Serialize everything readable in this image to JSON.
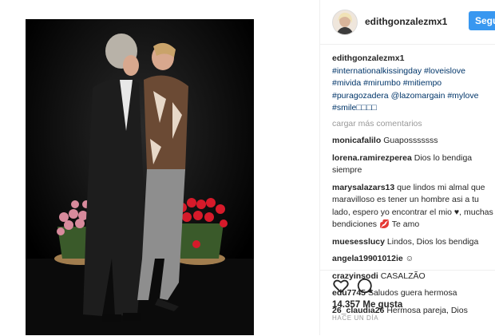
{
  "post": {
    "username": "edithgonzalezmx1",
    "follow_label": "Seguir",
    "caption_user": "edithgonzalezmx1",
    "caption_tags": "#internationalkissingday #loveislove #mivida #mirumbo #mitiempo #puragozadera",
    "caption_mention_line": "@lazomargain #mylove #smile",
    "caption_trailing": "□□□□"
  },
  "load_more_label": "cargar más comentarios",
  "comments": [
    {
      "user": "monicafalilo",
      "text": "Guaposssssss"
    },
    {
      "user": "lorena.ramirezperea",
      "text": "Dios lo bendiga siempre"
    },
    {
      "user": "marysalazars13",
      "text": "que lindos mi almal que maravilloso es tener un hombre asi a tu lado, espero yo encontrar el mio ♥, muchas bendiciones 💋 Te amo"
    },
    {
      "user": "muesesslucy",
      "text": "Lindos, Dios los bendiga"
    },
    {
      "user": "angela19901012ie",
      "text": "☺"
    },
    {
      "user": "crazyinsodi",
      "text": "CASALZÃO"
    },
    {
      "user": "edu7745",
      "text": "Saludos guera hermosa"
    },
    {
      "user": "26_claudia26",
      "text": "Hermosa pareja, Dios"
    }
  ],
  "likes_label": "14.357 Me gusta",
  "time_label": "HACE UN DÍA",
  "icons": {
    "like": "heart-icon",
    "comment": "comment-icon"
  }
}
